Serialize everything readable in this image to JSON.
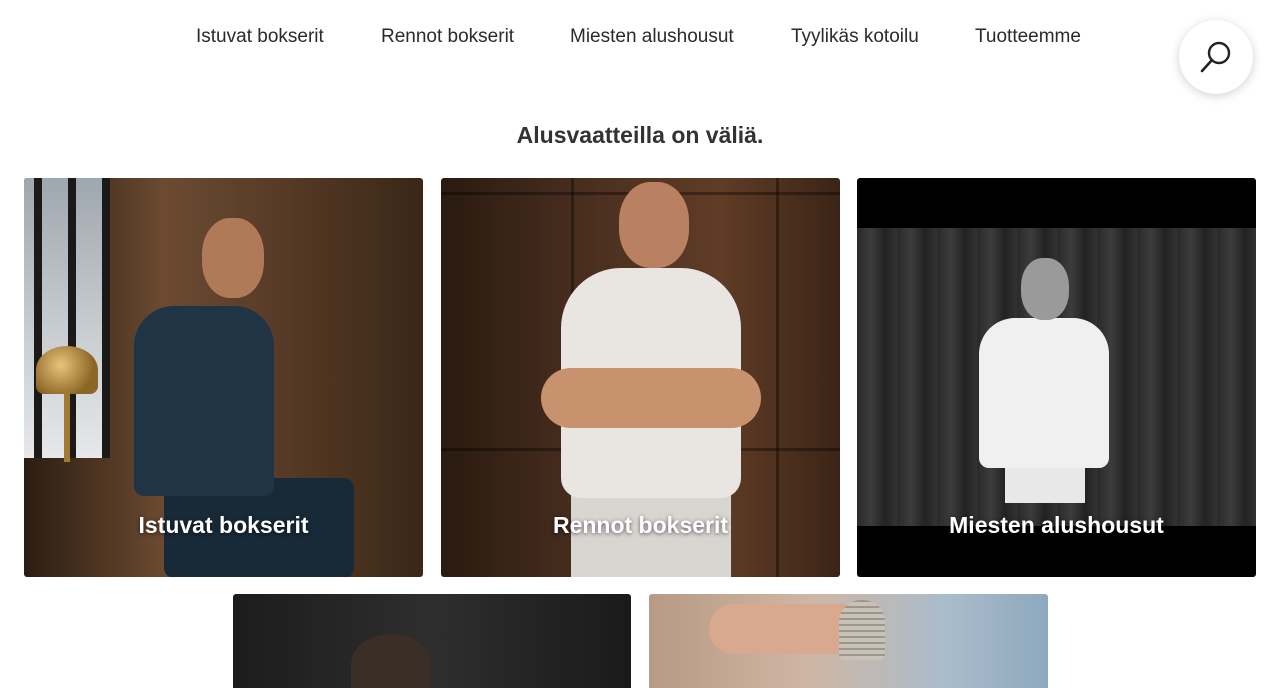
{
  "nav": {
    "items": [
      {
        "label": "Istuvat bokserit"
      },
      {
        "label": "Rennot bokserit"
      },
      {
        "label": "Miesten alushousut"
      },
      {
        "label": "Tyylikäs kotoilu"
      },
      {
        "label": "Tuotteemme"
      }
    ],
    "search_icon": "search-icon"
  },
  "main": {
    "headline": "Alusvaatteilla on väliä.",
    "cards": [
      {
        "label": "Istuvat bokserit"
      },
      {
        "label": "Rennot bokserit"
      },
      {
        "label": "Miesten alushousut"
      }
    ]
  }
}
